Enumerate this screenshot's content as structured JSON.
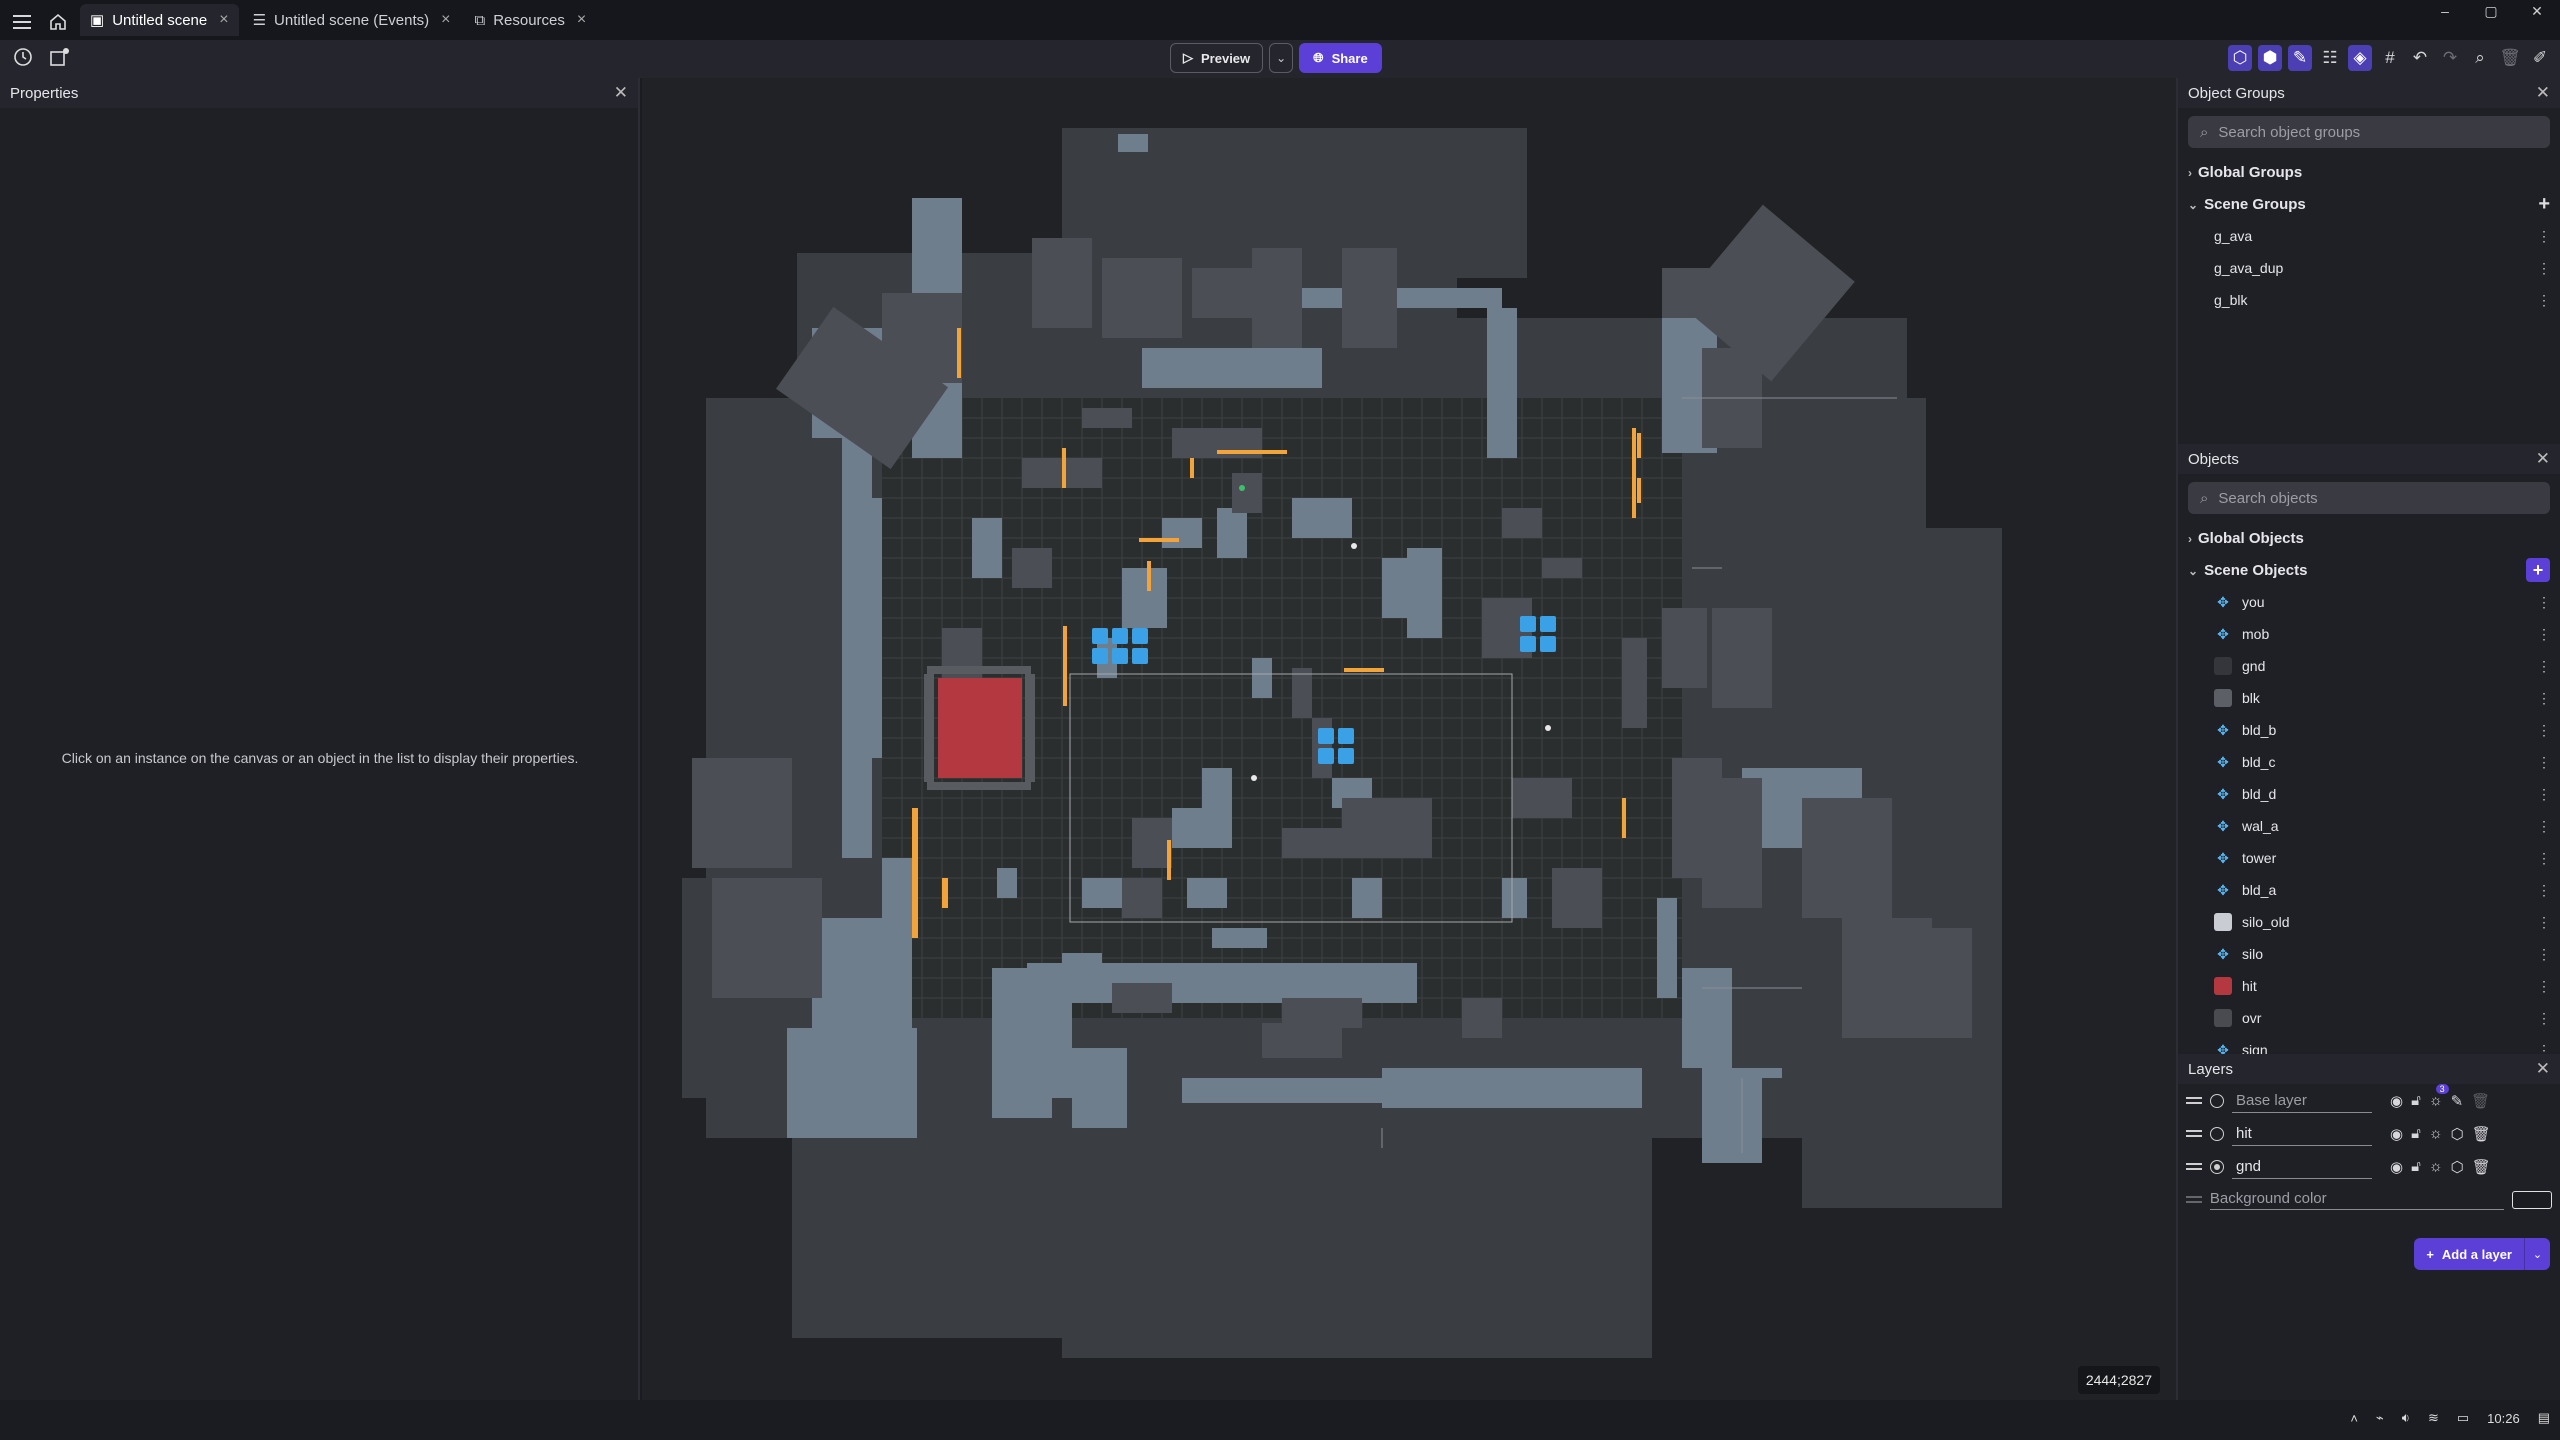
{
  "tabs": [
    {
      "label": "Untitled scene",
      "active": true
    },
    {
      "label": "Untitled scene (Events)",
      "active": false
    },
    {
      "label": "Resources",
      "active": false
    }
  ],
  "window_controls": {
    "minimize": "–",
    "maximize": "▢",
    "close": "✕"
  },
  "toolbar": {
    "preview_label": "Preview",
    "share_label": "Share"
  },
  "properties": {
    "title": "Properties",
    "hint": "Click on an instance on the canvas or an object in the list to display their properties."
  },
  "canvas": {
    "coords": "2444;2827",
    "colors": {
      "background": "#212226",
      "ground": "#3a3d42",
      "tile": "#6e7e8d",
      "accent": "#f2a43a",
      "hit": "#b3383f",
      "blue": "#3aa1e6"
    }
  },
  "object_groups": {
    "title": "Object Groups",
    "search_placeholder": "Search object groups",
    "global_label": "Global Groups",
    "scene_label": "Scene Groups",
    "items": [
      "g_ava",
      "g_ava_dup",
      "g_blk"
    ]
  },
  "objects": {
    "title": "Objects",
    "search_placeholder": "Search objects",
    "global_label": "Global Objects",
    "scene_label": "Scene Objects",
    "items": [
      {
        "name": "you",
        "icon": "sprite"
      },
      {
        "name": "mob",
        "icon": "sprite"
      },
      {
        "name": "gnd",
        "icon": "swatch",
        "color": "#35363c"
      },
      {
        "name": "blk",
        "icon": "swatch",
        "color": "#5d5f66"
      },
      {
        "name": "bld_b",
        "icon": "sprite"
      },
      {
        "name": "bld_c",
        "icon": "sprite"
      },
      {
        "name": "bld_d",
        "icon": "sprite"
      },
      {
        "name": "wal_a",
        "icon": "sprite"
      },
      {
        "name": "tower",
        "icon": "sprite"
      },
      {
        "name": "bld_a",
        "icon": "sprite"
      },
      {
        "name": "silo_old",
        "icon": "swatch",
        "color": "#c9ccd2"
      },
      {
        "name": "silo",
        "icon": "sprite"
      },
      {
        "name": "hit",
        "icon": "swatch",
        "color": "#b3383f"
      },
      {
        "name": "ovr",
        "icon": "swatch",
        "color": "#4a4b51"
      },
      {
        "name": "sign",
        "icon": "sprite"
      }
    ]
  },
  "layers": {
    "title": "Layers",
    "items": [
      {
        "name": "Base layer",
        "badge": "3",
        "dim": true,
        "selected": false
      },
      {
        "name": "hit",
        "dim": false,
        "selected": false
      },
      {
        "name": "gnd",
        "dim": false,
        "selected": true
      }
    ],
    "background_label": "Background color",
    "add_label": "Add a layer"
  },
  "tray": {
    "time": "10:26"
  },
  "accent": "#5b3fd6"
}
